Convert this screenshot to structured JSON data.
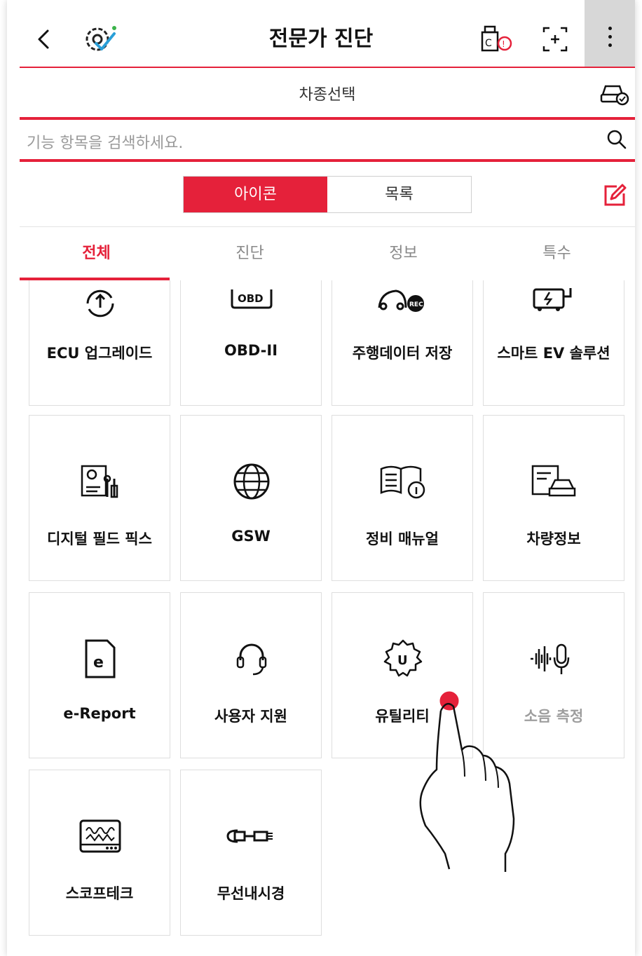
{
  "header": {
    "title": "전문가 진단",
    "back_icon": "chevron-left-icon",
    "logo_icon": "gear-check-logo-icon"
  },
  "vehicle": {
    "label": "차종선택"
  },
  "search": {
    "placeholder": "기능 항목을 검색하세요."
  },
  "view_toggle": {
    "icon_label": "아이콘",
    "list_label": "목록"
  },
  "tabs": [
    {
      "label": "전체",
      "active": true
    },
    {
      "label": "진단",
      "active": false
    },
    {
      "label": "정보",
      "active": false
    },
    {
      "label": "특수",
      "active": false
    }
  ],
  "grid": [
    {
      "label": "ECU 업그레이드",
      "icon": "ecu-upgrade-icon"
    },
    {
      "label": "OBD-II",
      "icon": "obd-icon"
    },
    {
      "label": "주행데이터 저장",
      "icon": "driving-record-icon"
    },
    {
      "label": "스마트 EV 솔루션",
      "icon": "ev-charger-icon"
    },
    {
      "label": "디지털 필드 픽스",
      "icon": "field-fix-icon"
    },
    {
      "label": "GSW",
      "icon": "globe-icon"
    },
    {
      "label": "정비 매뉴얼",
      "icon": "manual-icon"
    },
    {
      "label": "차량정보",
      "icon": "vehicle-info-icon"
    },
    {
      "label": "e-Report",
      "icon": "report-icon"
    },
    {
      "label": "사용자 지원",
      "icon": "headset-icon"
    },
    {
      "label": "유틸리티",
      "icon": "utility-gear-icon"
    },
    {
      "label": "소음 측정",
      "icon": "sound-measure-icon",
      "disabled": true
    },
    {
      "label": "스코프테크",
      "icon": "scope-icon"
    },
    {
      "label": "무선내시경",
      "icon": "endoscope-icon"
    }
  ],
  "colors": {
    "accent": "#e5213a",
    "touch_dot": "#e5213a"
  },
  "obd_icon_text": "OBD",
  "rec_badge": "REC"
}
